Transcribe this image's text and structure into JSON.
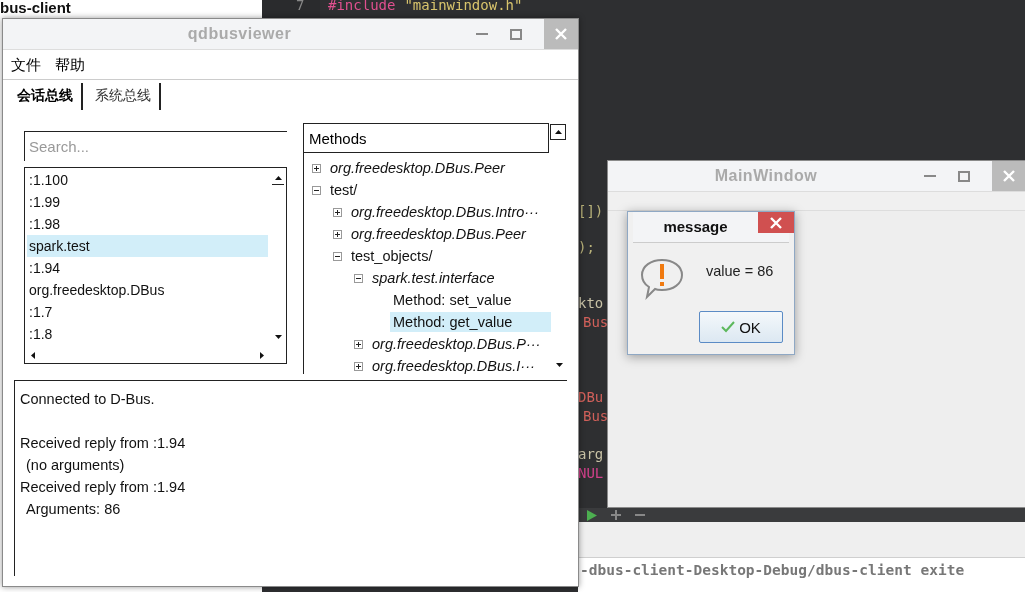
{
  "background_panel": {
    "title": "bus-client"
  },
  "editor": {
    "line_number": "7",
    "first_line": [
      {
        "text": "#include",
        "color": "#e0508f"
      },
      {
        "text": "\"mainwindow.h\"",
        "color": "#d8c46c"
      }
    ],
    "code_fragments": [
      {
        "text": "[])",
        "color": "#b9b27a"
      },
      {
        "text": ");",
        "color": "#b9b27a"
      },
      {
        "text": "kto",
        "color": "#c8c2a6"
      },
      {
        "text": "Bus",
        "color": "#d0605a"
      },
      {
        "text": "DBu",
        "color": "#d0605a"
      },
      {
        "text": "Bus",
        "color": "#d0605a"
      },
      {
        "text": "arg",
        "color": "#c8c2a6"
      },
      {
        "text": "NUL",
        "color": "#d0408a"
      }
    ],
    "output": "-dbus-client-Desktop-Debug/dbus-client exite"
  },
  "qdbusviewer": {
    "title": "qdbusviewer",
    "menu": [
      "文件",
      "帮助"
    ],
    "tabs": [
      {
        "label": "会话总线",
        "selected": true
      },
      {
        "label": "系统总线",
        "selected": false
      }
    ],
    "search": {
      "placeholder": "Search..."
    },
    "services": [
      {
        "label": ":1.100",
        "selected": false
      },
      {
        "label": ":1.99",
        "selected": false
      },
      {
        "label": ":1.98",
        "selected": false
      },
      {
        "label": "spark.test",
        "selected": true
      },
      {
        "label": ":1.94",
        "selected": false
      },
      {
        "label": "org.freedesktop.DBus",
        "selected": false
      },
      {
        "label": ":1.7",
        "selected": false
      },
      {
        "label": ":1.8",
        "selected": false
      }
    ],
    "tree": {
      "header": "Methods",
      "nodes": [
        {
          "label": "org.freedesktop.DBus.Peer",
          "kind": "interface",
          "expanded": false,
          "selected": false
        },
        {
          "label": "test/",
          "kind": "path",
          "expanded": true,
          "selected": false,
          "children": [
            {
              "label": "org.freedesktop.DBus.Intro···",
              "kind": "interface",
              "expanded": false,
              "selected": false
            },
            {
              "label": "org.freedesktop.DBus.Peer",
              "kind": "interface",
              "expanded": false,
              "selected": false
            },
            {
              "label": "test_objects/",
              "kind": "path",
              "expanded": true,
              "selected": false,
              "children": [
                {
                  "label": "spark.test.interface",
                  "kind": "interface",
                  "expanded": true,
                  "selected": false,
                  "children": [
                    {
                      "label": "Method: set_value",
                      "kind": "method",
                      "selected": false
                    },
                    {
                      "label": "Method: get_value",
                      "kind": "method",
                      "selected": true
                    }
                  ]
                },
                {
                  "label": "org.freedesktop.DBus.P···",
                  "kind": "interface",
                  "expanded": false,
                  "selected": false
                },
                {
                  "label": "org.freedesktop.DBus.I···",
                  "kind": "interface",
                  "expanded": false,
                  "selected": false
                }
              ]
            }
          ]
        }
      ]
    },
    "log": [
      {
        "text": "Connected to D-Bus.",
        "kind": "status"
      },
      {
        "text": "Received reply from :1.94",
        "kind": "reply"
      },
      {
        "text": "(no arguments)",
        "kind": "detail"
      },
      {
        "text": "Received reply from :1.94",
        "kind": "reply"
      },
      {
        "text": "Arguments: 86",
        "kind": "detail"
      }
    ]
  },
  "main_window": {
    "title": "MainWindow"
  },
  "message_dialog": {
    "title": "message",
    "text": "value = 86",
    "button": "OK"
  }
}
